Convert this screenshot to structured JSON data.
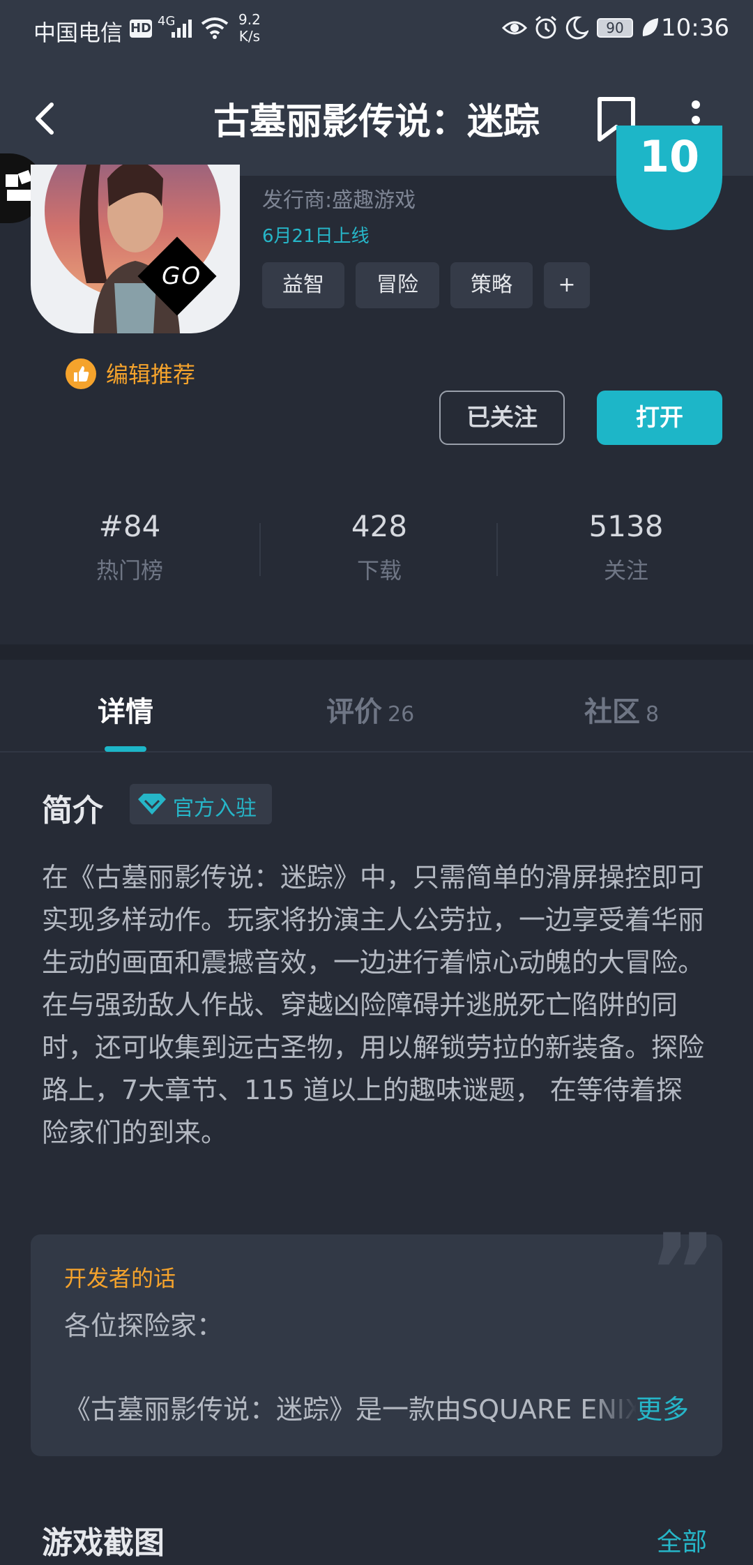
{
  "status_bar": {
    "carrier": "中国电信",
    "hd": "HD",
    "network": "4G",
    "speed_value": "9.2",
    "speed_unit": "K/s",
    "battery": "90",
    "time": "10:36"
  },
  "header": {
    "title": "古墓丽影传说：迷踪"
  },
  "game": {
    "publisher": "发行商:盛趣游戏",
    "launch_date": "6月21日上线",
    "icon_badge": "GO",
    "score": "10",
    "tags": [
      "益智",
      "冒险",
      "策略",
      "+"
    ],
    "editor_pick": "编辑推荐",
    "follow_label": "已关注",
    "open_label": "打开"
  },
  "stats": [
    {
      "value": "#84",
      "label": "热门榜"
    },
    {
      "value": "428",
      "label": "下载"
    },
    {
      "value": "5138",
      "label": "关注"
    }
  ],
  "tabs": [
    {
      "label": "详情",
      "count": ""
    },
    {
      "label": "评价",
      "count": "26"
    },
    {
      "label": "社区",
      "count": "8"
    }
  ],
  "intro": {
    "title": "简介",
    "badge": "官方入驻",
    "paragraphs": [
      "在《古墓丽影传说：迷踪》中，只需简单的滑屏操控即可实现多样动作。玩家将扮演主人公劳拉，一边享受着华丽生动的画面和震撼音效，一边进行着惊心动魄的大冒险。",
      "在与强劲敌人作战、穿越凶险障碍并逃脱死亡陷阱的同时，还可收集到远古圣物，用以解锁劳拉的新装备。探险路上，7大章节、115 道以上的趣味谜题， 在等待着探险家们的到来。"
    ]
  },
  "developer": {
    "title": "开发者的话",
    "greeting": "各位探险家：",
    "text": "《古墓丽影传说：迷踪》是一款由SQUARE ENIX",
    "more": "更多"
  },
  "screenshots": {
    "title": "游戏截图",
    "all": "全部"
  },
  "colors": {
    "accent": "#1db6c8",
    "orange": "#f5a32c",
    "background": "#262b36",
    "header": "#323946"
  }
}
